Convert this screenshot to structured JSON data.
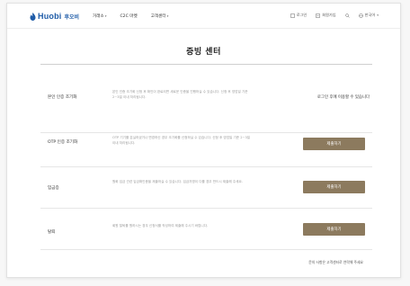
{
  "header": {
    "logo_text": "Huobi",
    "logo_korean": "후오비",
    "nav": [
      {
        "label": "거래소",
        "has_dropdown": true
      },
      {
        "label": "C2C 마켓",
        "has_dropdown": false
      },
      {
        "label": "고객센터",
        "has_dropdown": true
      }
    ],
    "utils": {
      "login": "로그인",
      "signup": "회원가입",
      "language": "한국어"
    }
  },
  "page_title": "증빙 센터",
  "rows": [
    {
      "name": "본인 인증 조기화",
      "desc": "본인 인증 조기화 신청 후 확인이 완료되면 새로운 인증을 진행하실 수 있습니다. 신청 후 영업일 기준 2~3일 이내 처리됩니다.",
      "note": "로그인 후에 이용할 수 있습니다",
      "button": null
    },
    {
      "name": "OTP 인증 조기화",
      "desc": "OTP 기기를 분실하셨거나 변경하신 경우 조기화를 신청하실 수 있습니다. 신청 후 영업일 기준 2~3일 이내 처리됩니다.",
      "note": null,
      "button": "제출하기"
    },
    {
      "name": "입금증",
      "desc": "원화 입금 관련 입금확인증을 제출하실 수 있습니다. 입금자명이 다를 경우 반드시 제출해 주세요.",
      "note": null,
      "button": "제출하기"
    },
    {
      "name": "탈퇴",
      "desc": "회원 탈퇴를 원하시는 경우 신청서를 작성하여 제출해 주시기 바랍니다.",
      "note": null,
      "button": "제출하기"
    }
  ],
  "footer_note": "문의 사항은 고객센터로 연락해 주세요",
  "colors": {
    "brand": "#1f5ca8",
    "button": "#8c7a5e"
  }
}
